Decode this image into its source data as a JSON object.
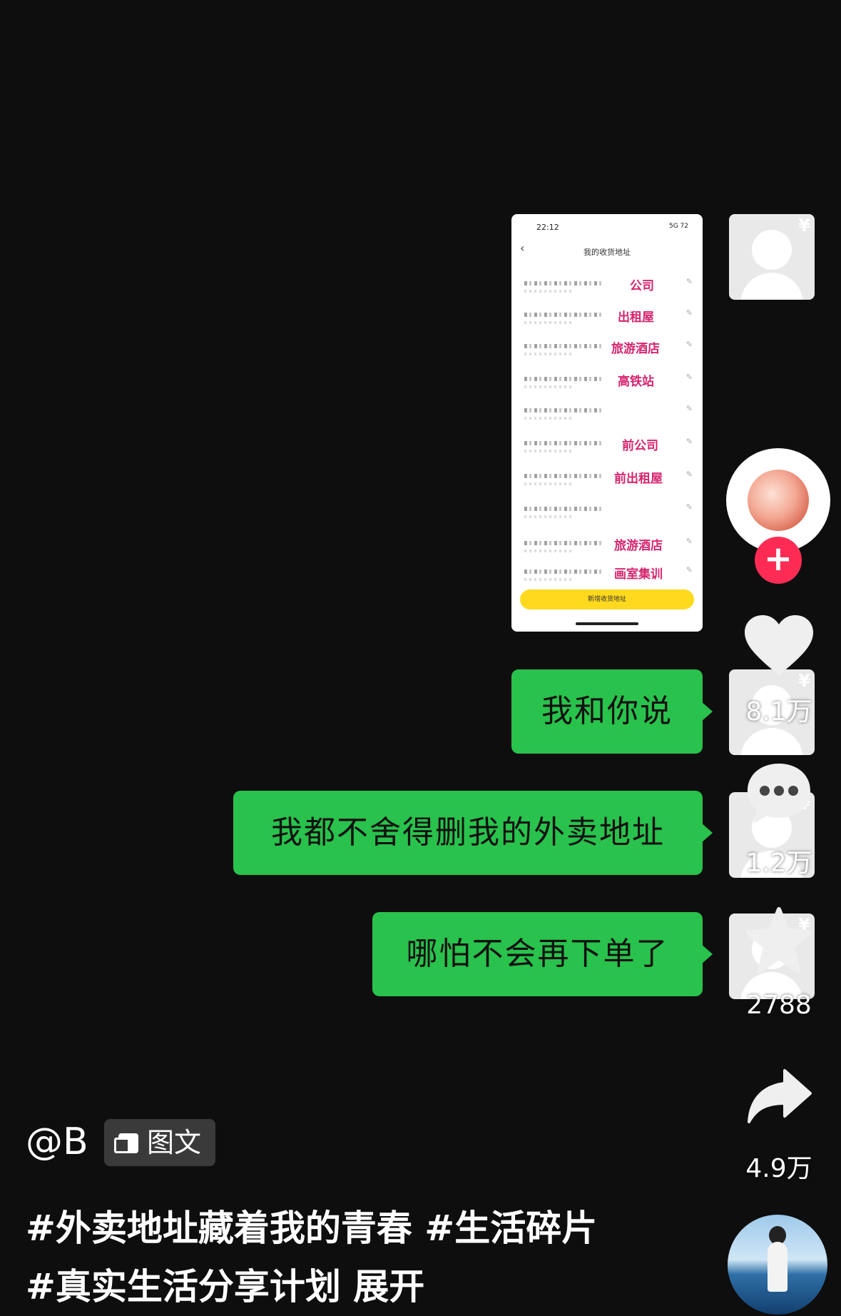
{
  "phone_screenshot": {
    "status_time": "22:12",
    "status_right": "5G 72",
    "title": "我的收货地址",
    "addresses": [
      {
        "label": "公司"
      },
      {
        "label": "出租屋"
      },
      {
        "label": "旅游酒店"
      },
      {
        "label": "高铁站"
      },
      {
        "label": ""
      },
      {
        "label": "前公司"
      },
      {
        "label": "前出租屋"
      },
      {
        "label": ""
      },
      {
        "label": "旅游酒店"
      },
      {
        "label": "画室集训"
      }
    ],
    "add_button": "新增收货地址"
  },
  "messages": [
    {
      "text": "我和你说"
    },
    {
      "text": "我都不舍得删我的外卖地址"
    },
    {
      "text": "哪怕不会再下单了"
    }
  ],
  "actions": {
    "like_count": "8.1万",
    "comment_count": "1.2万",
    "favorite_count": "2788",
    "share_count": "4.9万"
  },
  "post": {
    "author": "@B",
    "type_badge": "图文",
    "caption": "#外卖地址藏着我的青春 #生活碎片 #真实生活分享计划 展开"
  },
  "icons": {
    "follow": "plus-icon",
    "like": "heart-icon",
    "comment": "comment-dots-icon",
    "favorite": "star-icon",
    "share": "share-arrow-icon"
  },
  "colors": {
    "bubble_green": "#29c24c",
    "address_label": "#d6246e",
    "follow_red": "#fe2c55",
    "add_button_yellow": "#ffd91e"
  }
}
